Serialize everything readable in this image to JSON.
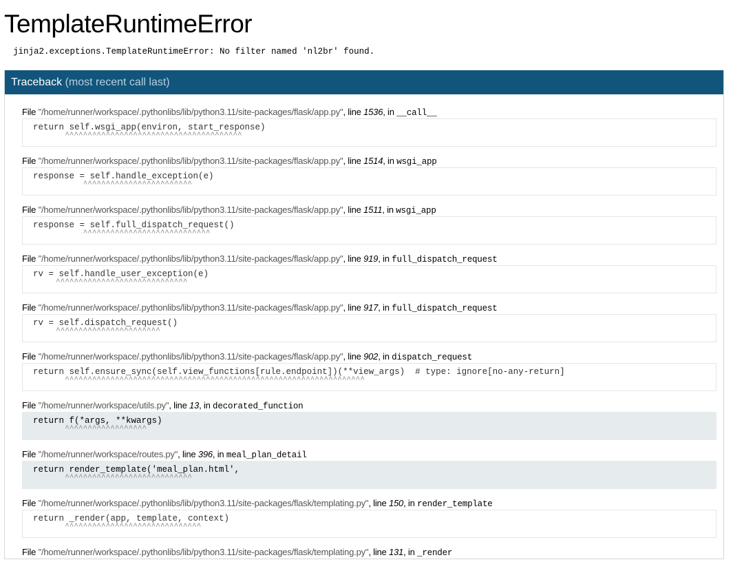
{
  "title": "TemplateRuntimeError",
  "error_message": "jinja2.exceptions.TemplateRuntimeError: No filter named 'nl2br' found.",
  "traceback": {
    "heading": "Traceback",
    "subheading": "(most recent call last)",
    "labels": {
      "file": "File ",
      "line": ", line ",
      "in": ", in "
    },
    "frames": [
      {
        "file": "\"/home/runner/workspace/.pythonlibs/lib/python3.11/site-packages/flask/app.py\"",
        "line": "1536",
        "func": "__call__",
        "code": "return self.wsgi_app(environ, start_response)",
        "caret": "       ^^^^^^^^^^^^^^^^^^^^^^^^^^^^^^^^^^^^^^^",
        "app": false
      },
      {
        "file": "\"/home/runner/workspace/.pythonlibs/lib/python3.11/site-packages/flask/app.py\"",
        "line": "1514",
        "func": "wsgi_app",
        "code": "response = self.handle_exception(e)",
        "caret": "           ^^^^^^^^^^^^^^^^^^^^^^^^",
        "app": false
      },
      {
        "file": "\"/home/runner/workspace/.pythonlibs/lib/python3.11/site-packages/flask/app.py\"",
        "line": "1511",
        "func": "wsgi_app",
        "code": "response = self.full_dispatch_request()",
        "caret": "           ^^^^^^^^^^^^^^^^^^^^^^^^^^^^",
        "app": false
      },
      {
        "file": "\"/home/runner/workspace/.pythonlibs/lib/python3.11/site-packages/flask/app.py\"",
        "line": "919",
        "func": "full_dispatch_request",
        "code": "rv = self.handle_user_exception(e)",
        "caret": "     ^^^^^^^^^^^^^^^^^^^^^^^^^^^^^",
        "app": false
      },
      {
        "file": "\"/home/runner/workspace/.pythonlibs/lib/python3.11/site-packages/flask/app.py\"",
        "line": "917",
        "func": "full_dispatch_request",
        "code": "rv = self.dispatch_request()",
        "caret": "     ^^^^^^^^^^^^^^^^^^^^^^^",
        "app": false
      },
      {
        "file": "\"/home/runner/workspace/.pythonlibs/lib/python3.11/site-packages/flask/app.py\"",
        "line": "902",
        "func": "dispatch_request",
        "code": "return self.ensure_sync(self.view_functions[rule.endpoint])(**view_args)  # type: ignore[no-any-return]",
        "caret": "       ^^^^^^^^^^^^^^^^^^^^^^^^^^^^^^^^^^^^^^^^^^^^^^^^^^^^^^^^^^^^^^^^^^",
        "app": false
      },
      {
        "file": "\"/home/runner/workspace/utils.py\"",
        "line": "13",
        "func": "decorated_function",
        "code": "return f(*args, **kwargs)",
        "caret": "       ^^^^^^^^^^^^^^^^^^",
        "app": true
      },
      {
        "file": "\"/home/runner/workspace/routes.py\"",
        "line": "396",
        "func": "meal_plan_detail",
        "code": "return render_template('meal_plan.html',",
        "caret": "       ^^^^^^^^^^^^^^^^^^^^^^^^^^^^",
        "app": true
      },
      {
        "file": "\"/home/runner/workspace/.pythonlibs/lib/python3.11/site-packages/flask/templating.py\"",
        "line": "150",
        "func": "render_template",
        "code": "return _render(app, template, context)",
        "caret": "       ^^^^^^^^^^^^^^^^^^^^^^^^^^^^^^",
        "app": false
      },
      {
        "file": "\"/home/runner/workspace/.pythonlibs/lib/python3.11/site-packages/flask/templating.py\"",
        "line": "131",
        "func": "_render",
        "code": "",
        "caret": "",
        "app": false
      }
    ]
  }
}
